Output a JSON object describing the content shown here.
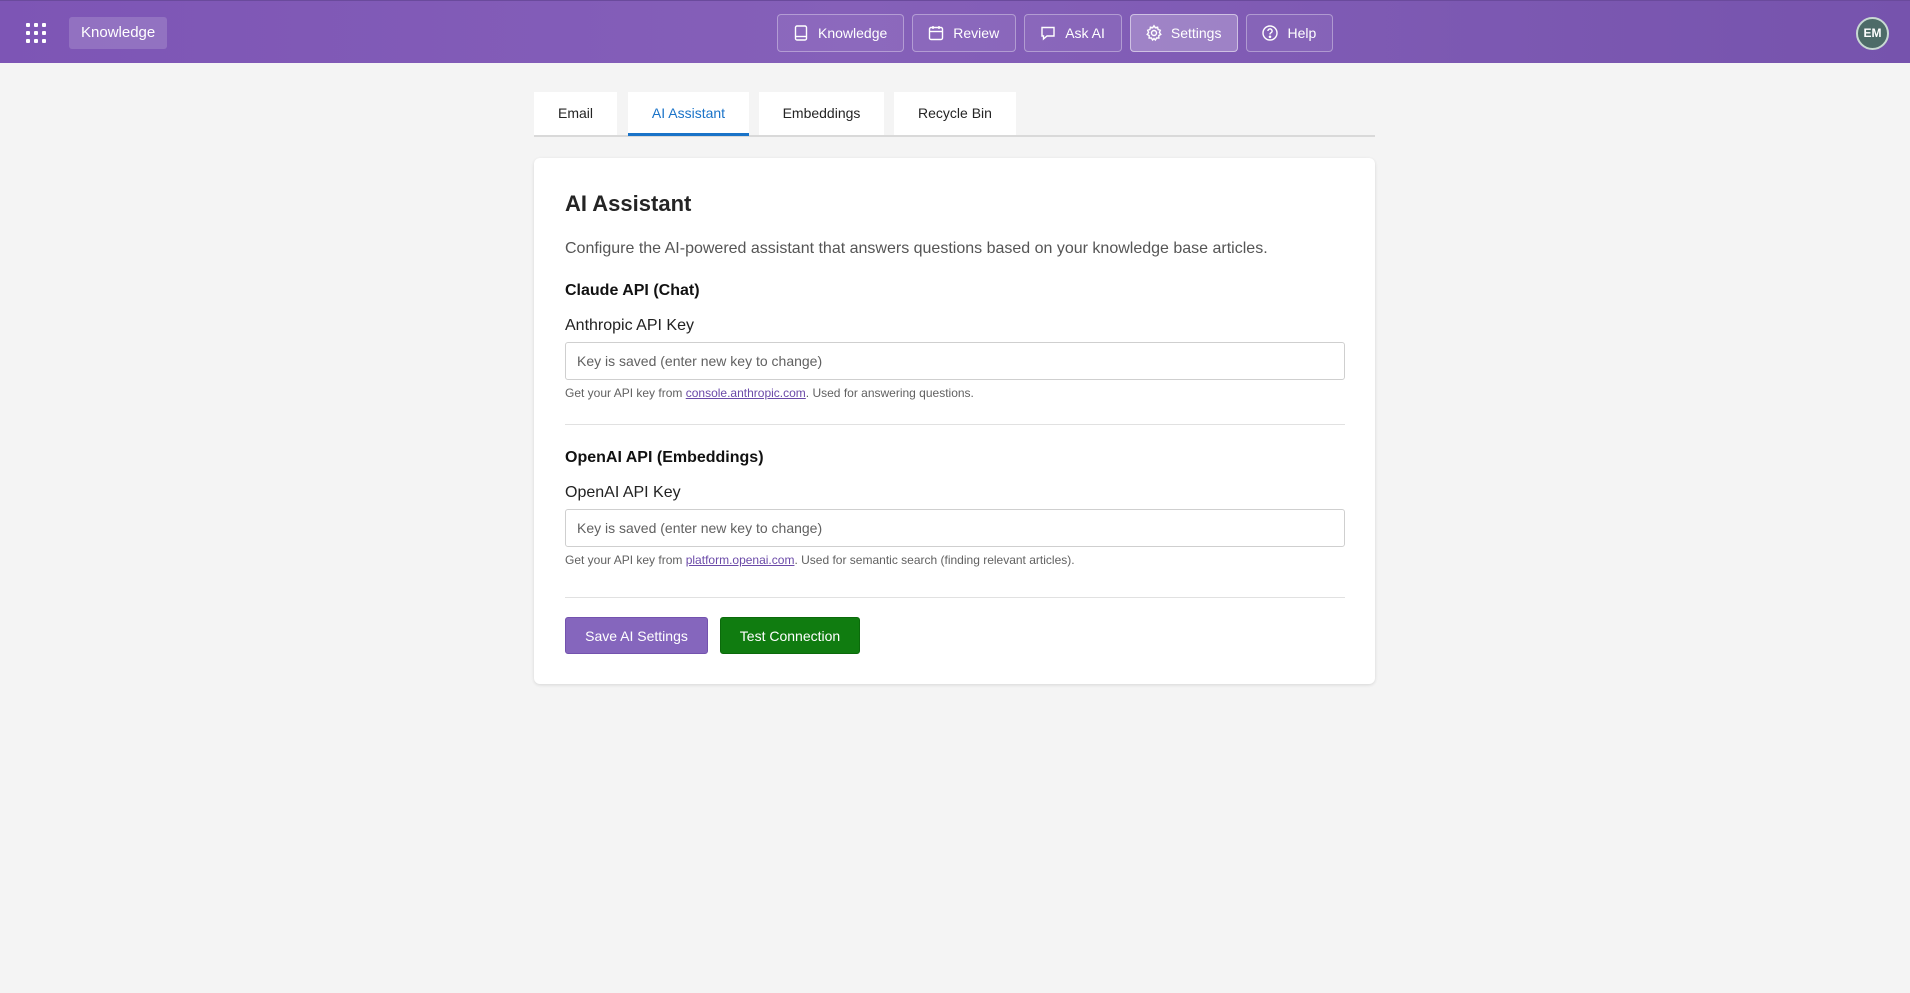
{
  "header": {
    "app_name": "Knowledge",
    "nav": [
      {
        "label": "Knowledge",
        "icon": "book-icon"
      },
      {
        "label": "Review",
        "icon": "calendar-icon"
      },
      {
        "label": "Ask AI",
        "icon": "chat-icon"
      },
      {
        "label": "Settings",
        "icon": "gear-icon",
        "active": true
      },
      {
        "label": "Help",
        "icon": "help-icon"
      }
    ],
    "avatar_initials": "EM"
  },
  "tabs": [
    {
      "label": "Email"
    },
    {
      "label": "AI Assistant",
      "active": true
    },
    {
      "label": "Embeddings"
    },
    {
      "label": "Recycle Bin"
    }
  ],
  "card": {
    "title": "AI Assistant",
    "description": "Configure the AI-powered assistant that answers questions based on your knowledge base articles.",
    "claude": {
      "section_title": "Claude API (Chat)",
      "field_label": "Anthropic API Key",
      "placeholder": "Key is saved (enter new key to change)",
      "value": "",
      "hint_prefix": "Get your API key from ",
      "hint_link": "console.anthropic.com",
      "hint_suffix": ". Used for answering questions."
    },
    "openai": {
      "section_title": "OpenAI API (Embeddings)",
      "field_label": "OpenAI API Key",
      "placeholder": "Key is saved (enter new key to change)",
      "value": "",
      "hint_prefix": "Get your API key from ",
      "hint_link": "platform.openai.com",
      "hint_suffix": ". Used for semantic search (finding relevant articles)."
    },
    "save_label": "Save AI Settings",
    "test_label": "Test Connection"
  },
  "colors": {
    "header_purple": "#8560b9",
    "active_tab_blue": "#1a73c8",
    "save_button": "#8566bd",
    "test_button": "#107c10"
  }
}
